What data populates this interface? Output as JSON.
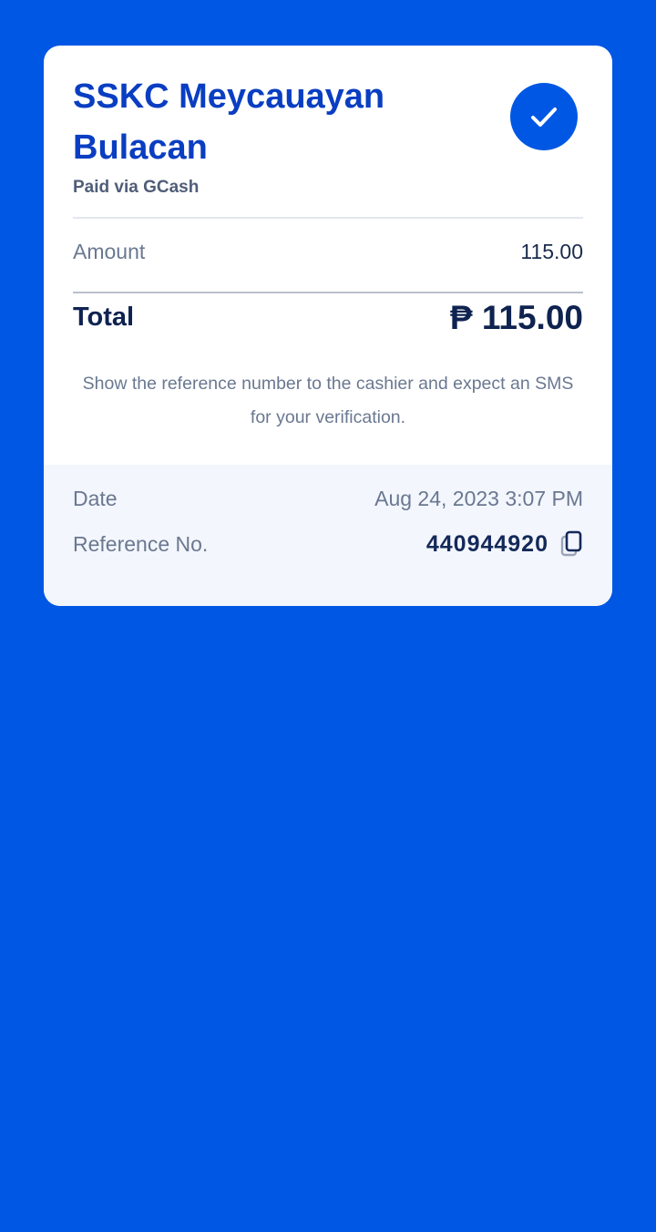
{
  "receipt": {
    "merchant": "SSKC Meycauayan Bulacan",
    "paid_via": "Paid via GCash",
    "amount_label": "Amount",
    "amount_value": "115.00",
    "total_label": "Total",
    "total_value": "₱ 115.00",
    "note": "Show the reference number to the cashier and expect an SMS for your verification.",
    "date_label": "Date",
    "date_value": "Aug 24, 2023 3:07 PM",
    "reference_label": "Reference No.",
    "reference_value": "440944920"
  },
  "icons": {
    "status": "check-icon",
    "copy": "copy-icon"
  },
  "colors": {
    "background": "#0057e4",
    "card": "#ffffff",
    "merchant_title": "#0a3ec2",
    "details_panel": "#f3f6fc"
  }
}
